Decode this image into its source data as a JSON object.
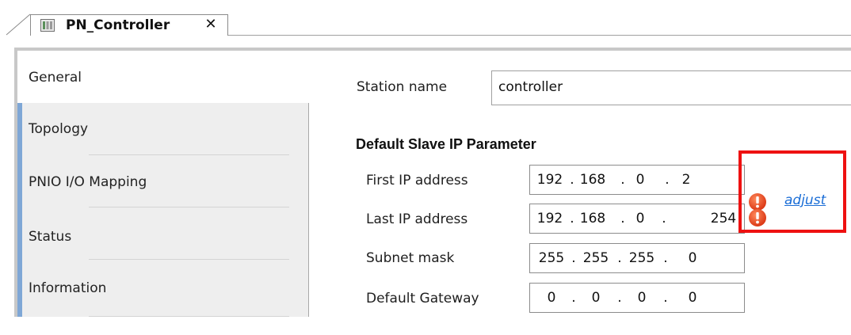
{
  "tab": {
    "title": "PN_Controller",
    "close_glyph": "✕",
    "icon": "device-icon"
  },
  "nav": {
    "items": [
      {
        "label": "General",
        "active": true
      },
      {
        "label": "Topology",
        "active": false
      },
      {
        "label": "PNIO I/O Mapping",
        "active": false
      },
      {
        "label": "Status",
        "active": false
      },
      {
        "label": "Information",
        "active": false
      }
    ]
  },
  "general": {
    "station_name_label": "Station name",
    "station_name_value": "controller",
    "section_title": "Default Slave IP Parameter",
    "fields": [
      {
        "label": "First IP address",
        "octets": [
          "192",
          "168",
          "0",
          "2"
        ],
        "error": true
      },
      {
        "label": "Last IP address",
        "octets": [
          "192",
          "168",
          "0",
          "254"
        ],
        "error": true
      },
      {
        "label": "Subnet mask",
        "octets": [
          "255",
          "255",
          "255",
          "0"
        ],
        "error": false
      },
      {
        "label": "Default Gateway",
        "octets": [
          "0",
          "0",
          "0",
          "0"
        ],
        "error": false
      }
    ],
    "adjust_label": "adjust",
    "separator": "."
  },
  "colors": {
    "error_icon": "#e8401c",
    "link": "#1a6dd6",
    "highlight_border": "#ee1111",
    "nav_accent": "#7fa7d6"
  }
}
